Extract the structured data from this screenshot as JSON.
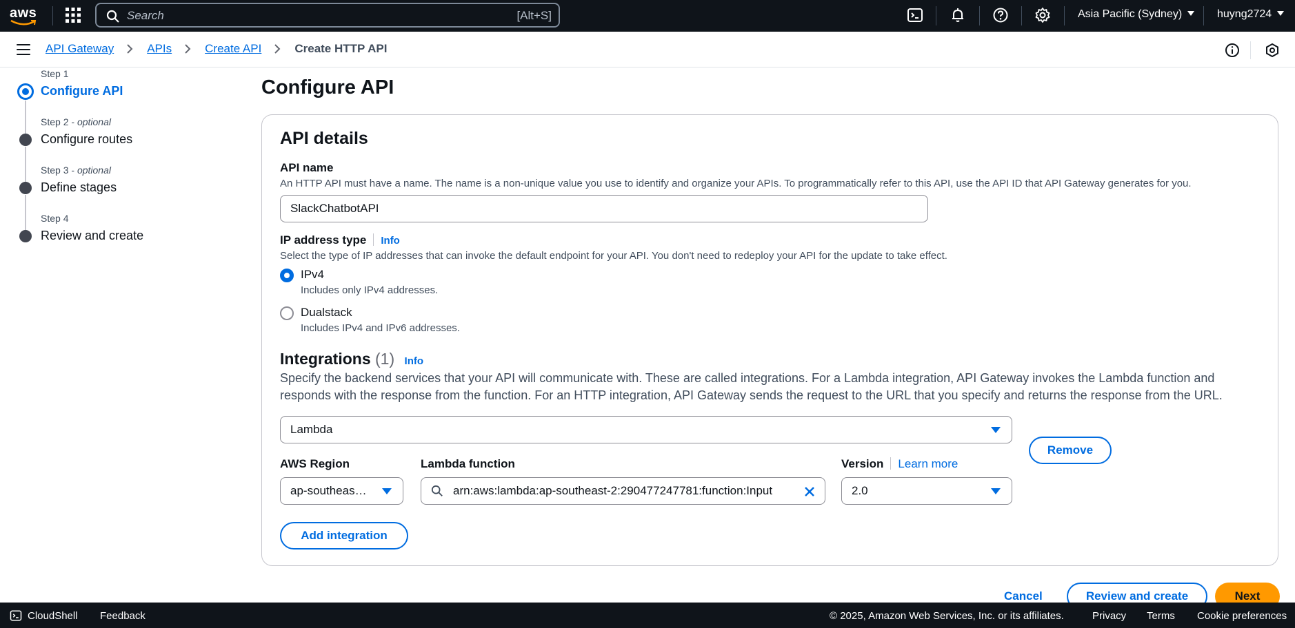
{
  "topnav": {
    "logo": "aws",
    "search_placeholder": "Search",
    "search_shortcut": "[Alt+S]",
    "region": "Asia Pacific (Sydney)",
    "user": "huyng2724",
    "icons": [
      "cloudshell-icon",
      "bell-icon",
      "help-icon",
      "settings-icon"
    ]
  },
  "breadcrumb": {
    "items": [
      "API Gateway",
      "APIs",
      "Create API"
    ],
    "current": "Create HTTP API"
  },
  "steps": [
    {
      "label": "Step 1",
      "optional": "",
      "title": "Configure API",
      "active": true
    },
    {
      "label": "Step 2",
      "optional": "optional",
      "title": "Configure routes",
      "active": false
    },
    {
      "label": "Step 3",
      "optional": "optional",
      "title": "Define stages",
      "active": false
    },
    {
      "label": "Step 4",
      "optional": "",
      "title": "Review and create",
      "active": false
    }
  ],
  "main": {
    "title": "Configure API",
    "panel_title": "API details",
    "api_name": {
      "label": "API name",
      "description": "An HTTP API must have a name. The name is a non-unique value you use to identify and organize your APIs. To programmatically refer to this API, use the API ID that API Gateway generates for you.",
      "value": "SlackChatbotAPI"
    },
    "ip_type": {
      "label": "IP address type",
      "info": "Info",
      "description": "Select the type of IP addresses that can invoke the default endpoint for your API. You don't need to redeploy your API for the update to take effect.",
      "options": [
        {
          "label": "IPv4",
          "desc": "Includes only IPv4 addresses.",
          "selected": true
        },
        {
          "label": "Dualstack",
          "desc": "Includes IPv4 and IPv6 addresses.",
          "selected": false
        }
      ]
    },
    "integrations": {
      "title": "Integrations",
      "count": "(1)",
      "info": "Info",
      "description": "Specify the backend services that your API will communicate with. These are called integrations. For a Lambda integration, API Gateway invokes the Lambda function and responds with the response from the function. For an HTTP integration, API Gateway sends the request to the URL that you specify and returns the response from the URL.",
      "type_value": "Lambda",
      "remove_label": "Remove",
      "region_label": "AWS Region",
      "region_value": "ap-southeas…",
      "function_label": "Lambda function",
      "function_value": "arn:aws:lambda:ap-southeast-2:290477247781:function:Input",
      "version_label": "Version",
      "learn_more": "Learn more",
      "version_value": "2.0",
      "add_label": "Add integration"
    },
    "actions": {
      "cancel": "Cancel",
      "review": "Review and create",
      "next": "Next"
    }
  },
  "footer": {
    "cloudshell": "CloudShell",
    "feedback": "Feedback",
    "copyright": "© 2025, Amazon Web Services, Inc. or its affiliates.",
    "privacy": "Privacy",
    "terms": "Terms",
    "cookies": "Cookie preferences"
  },
  "colors": {
    "nav_bg": "#0f141a",
    "accent": "#006ce0",
    "primary_button": "#ff9900"
  }
}
